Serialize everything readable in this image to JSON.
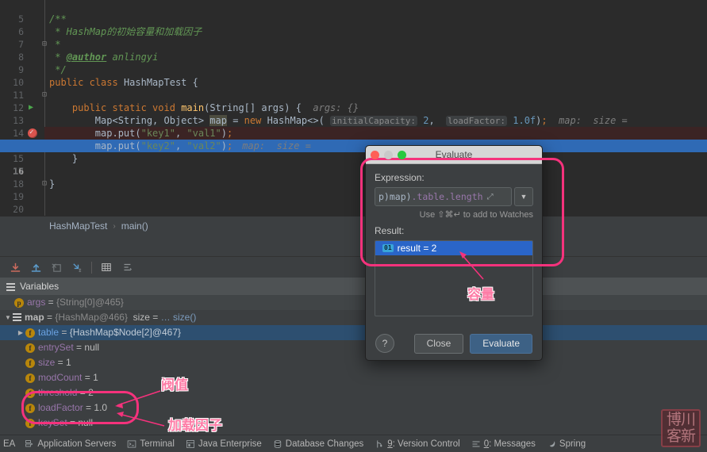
{
  "editor": {
    "lines": [
      {
        "num": "5",
        "text": ""
      },
      {
        "num": "6",
        "text": "/**",
        "fold": "minus"
      },
      {
        "num": "7",
        "text": " * HashMap的初始容量和加载因子"
      },
      {
        "num": "8",
        "text": " *"
      },
      {
        "num": "9",
        "text": " * @author anlingyi"
      },
      {
        "num": "10",
        "text": " */",
        "fold": "end"
      },
      {
        "num": "11",
        "text": "public class HashMapTest {",
        "run": true
      },
      {
        "num": "12",
        "text": ""
      },
      {
        "num": "13",
        "text": "    public static void main(String[] args) {",
        "run": true,
        "inlay": "args: {}"
      },
      {
        "num": "14",
        "text": "        Map<String, Object> map = new HashMap<>( initialCapacity: 2,  loadFactor: 1.0f);",
        "hint": "map:  size ="
      },
      {
        "num": "15",
        "text": "        map.put(\"key1\", \"val1\");",
        "breakpoint": true
      },
      {
        "num": "16",
        "text": "        map.put(\"key2\", \"val2\");",
        "current": true,
        "hint": "map:  size ="
      },
      {
        "num": "17",
        "text": "    }",
        "fold": "end"
      },
      {
        "num": "18",
        "text": ""
      },
      {
        "num": "19",
        "text": "}"
      },
      {
        "num": "20",
        "text": ""
      }
    ],
    "inlay_initial_capacity_label": "initialCapacity:",
    "inlay_initial_capacity_value": "2",
    "inlay_load_factor_label": "loadFactor:",
    "inlay_load_factor_value": "1.0f",
    "inlay_args_label": "args:",
    "inlay_args_value": "{}",
    "hint_map_size": "map:  size ="
  },
  "breadcrumb": {
    "class": "HashMapTest",
    "separator": "›",
    "method": "main()"
  },
  "debug_toolbar": {
    "buttons": [
      {
        "name": "restore-layout-icon",
        "title": "Restore Layout"
      },
      {
        "name": "export-icon",
        "title": "Export"
      },
      {
        "name": "mute-breakpoints-icon",
        "title": "Mute Breakpoints"
      },
      {
        "name": "settings-jump-icon",
        "title": "Jump to Source"
      },
      {
        "name": "table-view-icon",
        "title": "Table View"
      },
      {
        "name": "sort-icon",
        "title": "Sort"
      }
    ]
  },
  "variables": {
    "header": "Variables",
    "rows": [
      {
        "indent": 1,
        "badge": "p",
        "name": "args",
        "eq": "=",
        "value": "{String[0]@465}",
        "value_style": "obj",
        "arrow": "",
        "selected": false,
        "alt": true
      },
      {
        "indent": 0,
        "badge": "list",
        "name": "map",
        "eq": "=",
        "value": "{HashMap@466}",
        "value_style": "obj",
        "extra": "size =",
        "extra2": "… size()",
        "arrow": "down",
        "selected": false,
        "alt": false
      },
      {
        "indent": 1,
        "badge": "f",
        "name": "table",
        "eq": "=",
        "value": "{HashMap$Node[2]@467}",
        "value_style": "obj",
        "arrow": "right",
        "selected": true,
        "alt": false,
        "name_blue": true
      },
      {
        "indent": 2,
        "badge": "f",
        "name": "entrySet",
        "eq": "=",
        "value": "null",
        "value_style": "plain",
        "arrow": "",
        "selected": false,
        "alt": false
      },
      {
        "indent": 2,
        "badge": "f",
        "name": "size",
        "eq": "=",
        "value": "1",
        "value_style": "plain",
        "arrow": "",
        "selected": false,
        "alt": false
      },
      {
        "indent": 2,
        "badge": "f",
        "name": "modCount",
        "eq": "=",
        "value": "1",
        "value_style": "plain",
        "arrow": "",
        "selected": false,
        "alt": false
      },
      {
        "indent": 2,
        "badge": "f",
        "name": "threshold",
        "eq": "=",
        "value": "2",
        "value_style": "plain",
        "arrow": "",
        "selected": false,
        "alt": false
      },
      {
        "indent": 2,
        "badge": "f",
        "name": "loadFactor",
        "eq": "=",
        "value": "1.0",
        "value_style": "plain",
        "arrow": "",
        "selected": false,
        "alt": false
      },
      {
        "indent": 2,
        "badge": "f",
        "name": "keySet",
        "eq": "=",
        "value": "null",
        "value_style": "plain",
        "arrow": "",
        "selected": false,
        "alt": false
      }
    ]
  },
  "dialog": {
    "title": "Evaluate",
    "expression_label": "Expression:",
    "expression_value": "p)map).table.length",
    "expression_prefix": "p)map)",
    "expression_suffix": ".table.length",
    "watch_hint": "Use ⇧⌘↵ to add to Watches",
    "result_label": "Result:",
    "result_badge": "01",
    "result_text": "result = 2",
    "help_label": "?",
    "close_label": "Close",
    "evaluate_label": "Evaluate"
  },
  "annotations": {
    "capacity": "容量",
    "threshold": "阀值",
    "load_factor": "加载因子",
    "color": "#f5327c"
  },
  "statusbar": {
    "left_truncated": "EA",
    "items": [
      {
        "label": "Application Servers",
        "icon": "server-icon",
        "underline": ""
      },
      {
        "label": "Terminal",
        "icon": "terminal-icon",
        "underline": ""
      },
      {
        "label": "Java Enterprise",
        "icon": "javaee-icon",
        "underline": ""
      },
      {
        "label": "Database Changes",
        "icon": "database-icon",
        "underline": ""
      },
      {
        "label": "9: Version Control",
        "icon": "vcs-icon",
        "underline": "9"
      },
      {
        "label": "0: Messages",
        "icon": "messages-icon",
        "underline": "0"
      },
      {
        "label": "Spring",
        "icon": "spring-icon",
        "underline": ""
      }
    ]
  },
  "watermark": {
    "line1": "博川",
    "line2": "客新"
  }
}
